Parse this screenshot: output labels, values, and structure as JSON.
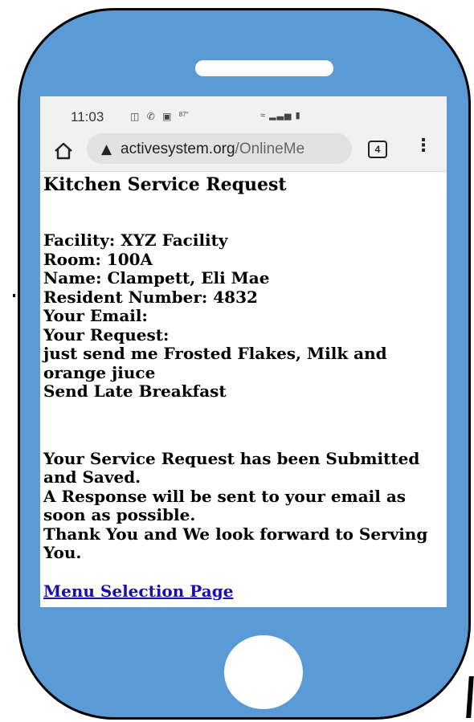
{
  "status_bar": {
    "time": "11:03",
    "battery_level": "87°"
  },
  "browser": {
    "url_domain": "activesystem.org",
    "url_path": "/OnlineMe",
    "tab_count": "4"
  },
  "page": {
    "heading": "Kitchen Service Request",
    "facility": "Facility: XYZ Facility",
    "room": "Room: 100A",
    "name": "Name: Clampett, Eli Mae",
    "resident_number": "Resident Number: 4832",
    "email_label": "Your Email:",
    "request_label": "Your Request:",
    "request_text": "just send me Frosted Flakes, Milk and orange jiuce",
    "request_extra": "Send Late Breakfast",
    "confirmation_1": "Your Service Request has been Submitted and Saved.",
    "confirmation_2": "A Response will be sent to your email as soon as possible.",
    "confirmation_3": "Thank You and We look forward to Serving You.",
    "menu_link": "Menu Selection Page"
  },
  "icons": {
    "home": "home-icon",
    "warning": "warning-icon",
    "tabs": "tab-count-icon",
    "menu": "more-vert-icon"
  },
  "colors": {
    "phone_body": "#5b9bd5",
    "link": "#1a0dab"
  }
}
